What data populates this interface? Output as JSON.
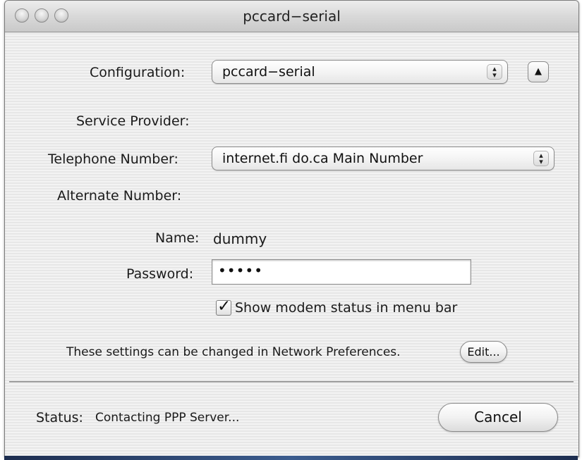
{
  "window": {
    "title": "pccard−serial",
    "controls": [
      "close-button",
      "minimize-button",
      "zoom-button"
    ]
  },
  "form": {
    "configuration": {
      "label": "Configuration:",
      "value": "pccard−serial"
    },
    "service_provider": {
      "label": "Service Provider:",
      "value": ""
    },
    "telephone_number": {
      "label": "Telephone Number:",
      "value": "internet.fi do.ca Main Number"
    },
    "alternate_number": {
      "label": "Alternate Number:",
      "value": ""
    },
    "name": {
      "label": "Name:",
      "value": "dummy"
    },
    "password": {
      "label": "Password:",
      "value": "•••••"
    },
    "show_modem_status": {
      "label": "Show modem status in menu bar",
      "checked": true,
      "mark": "✓"
    }
  },
  "network_note": {
    "text": "These settings can be changed in Network Preferences.",
    "edit_label": "Edit..."
  },
  "status": {
    "prefix": "Status:",
    "text": "Contacting PPP Server...",
    "cancel_label": "Cancel"
  },
  "icons": {
    "popup": "up-down-arrows-icon",
    "collapse": "triangle-up-icon",
    "check": "checkmark-icon"
  }
}
